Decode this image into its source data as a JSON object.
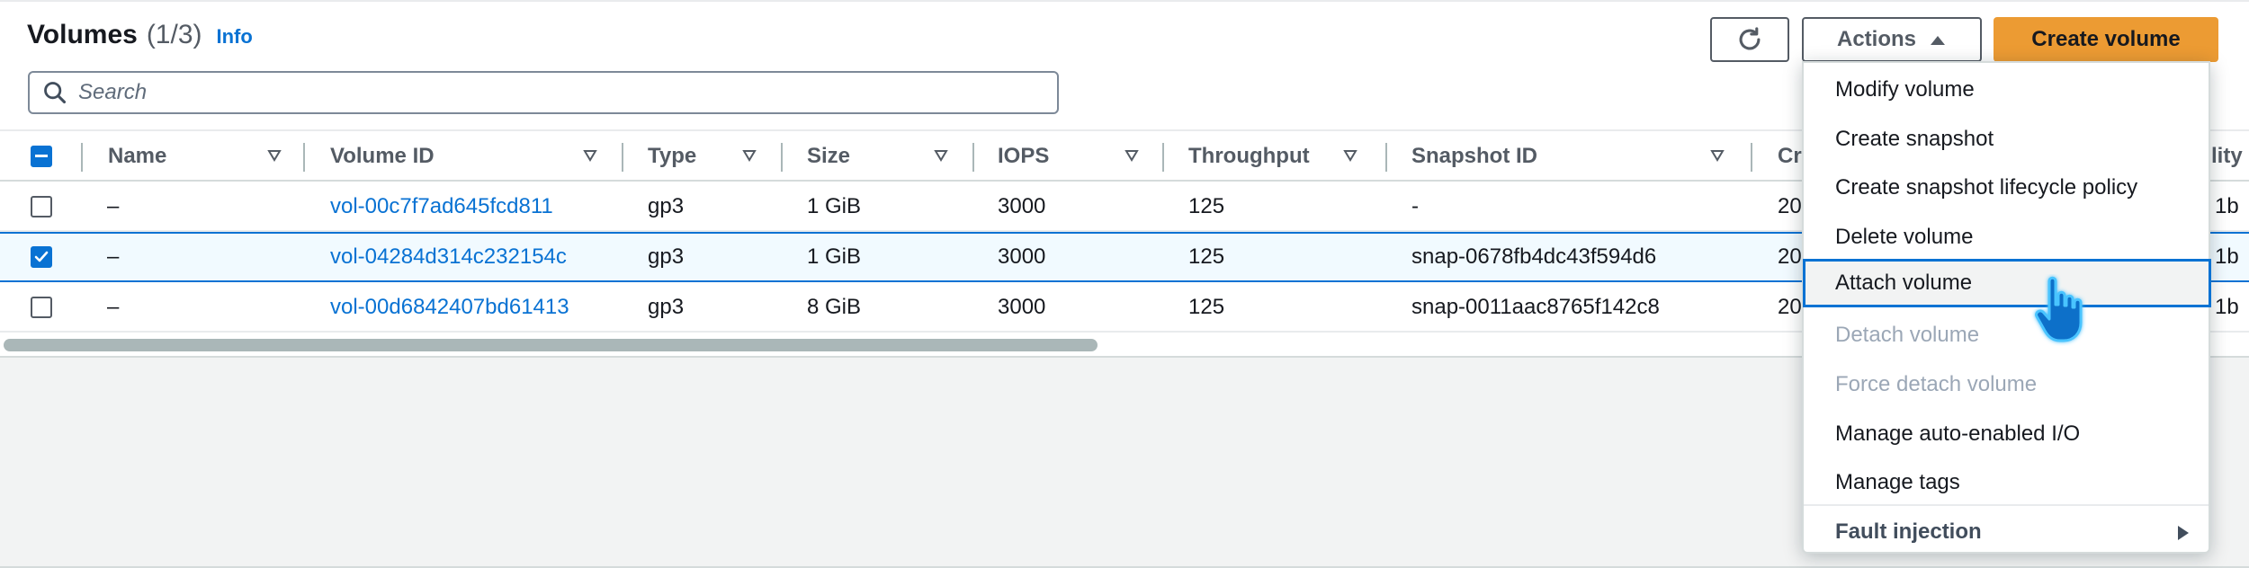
{
  "header": {
    "title": "Volumes",
    "count": "(1/3)",
    "info_link": "Info"
  },
  "toolbar": {
    "refresh_icon": "refresh-icon",
    "actions_label": "Actions",
    "create_label": "Create volume"
  },
  "search": {
    "placeholder": "Search"
  },
  "table": {
    "columns": [
      "Name",
      "Volume ID",
      "Type",
      "Size",
      "IOPS",
      "Throughput",
      "Snapshot ID",
      "Cr",
      "lity"
    ],
    "rows": [
      {
        "selected": false,
        "name": "–",
        "volume_id": "vol-00c7f7ad645fcd811",
        "type": "gp3",
        "size": "1 GiB",
        "iops": "3000",
        "throughput": "125",
        "snapshot_id": "-",
        "created": "20",
        "az": "1b"
      },
      {
        "selected": true,
        "name": "–",
        "volume_id": "vol-04284d314c232154c",
        "type": "gp3",
        "size": "1 GiB",
        "iops": "3000",
        "throughput": "125",
        "snapshot_id": "snap-0678fb4dc43f594d6",
        "created": "20",
        "az": "1b"
      },
      {
        "selected": false,
        "name": "–",
        "volume_id": "vol-00d6842407bd61413",
        "type": "gp3",
        "size": "8 GiB",
        "iops": "3000",
        "throughput": "125",
        "snapshot_id": "snap-0011aac8765f142c8",
        "created": "20",
        "az": "1b"
      }
    ]
  },
  "actions_menu": {
    "items": [
      {
        "label": "Modify volume",
        "state": "enabled"
      },
      {
        "label": "Create snapshot",
        "state": "enabled"
      },
      {
        "label": "Create snapshot lifecycle policy",
        "state": "enabled"
      },
      {
        "label": "Delete volume",
        "state": "enabled"
      },
      {
        "label": "Attach volume",
        "state": "highlighted"
      },
      {
        "label": "Detach volume",
        "state": "disabled"
      },
      {
        "label": "Force detach volume",
        "state": "disabled"
      },
      {
        "label": "Manage auto-enabled I/O",
        "state": "enabled"
      },
      {
        "label": "Manage tags",
        "state": "enabled"
      },
      {
        "label": "Fault injection",
        "state": "submenu"
      }
    ]
  },
  "colors": {
    "link": "#0972d3",
    "primary_button": "#ec9b33",
    "selected_row": "#f1faff"
  }
}
